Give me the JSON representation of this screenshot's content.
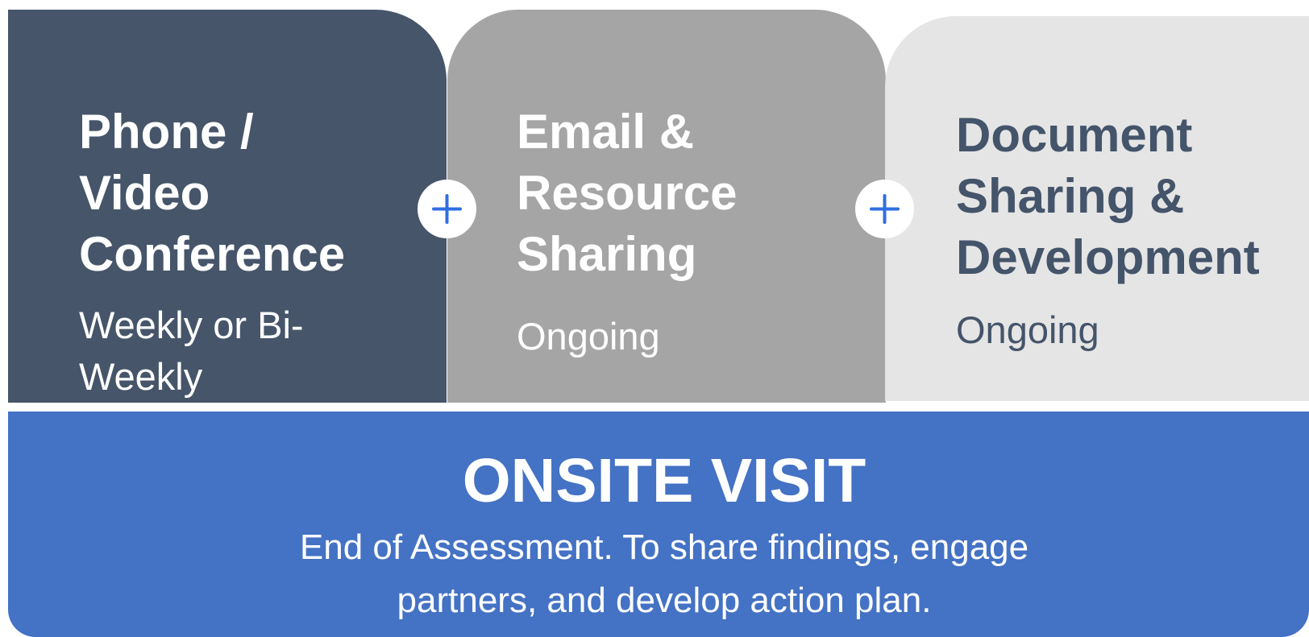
{
  "cards": [
    {
      "title": "Phone / Video Conference",
      "title_lines": [
        "Phone /",
        "Video",
        "Conference"
      ],
      "subtitle_lines": [
        "Weekly or Bi-",
        "Weekly"
      ],
      "color": "#465569"
    },
    {
      "title": "Email & Resource Sharing",
      "title_lines": [
        "Email &",
        "Resource",
        "Sharing"
      ],
      "subtitle_lines": [
        "Ongoing"
      ],
      "color": "#a5a5a5"
    },
    {
      "title": "Document Sharing & Development",
      "title_lines": [
        "Document",
        "Sharing &",
        "Development"
      ],
      "subtitle_lines": [
        "Ongoing"
      ],
      "color": "#e5e5e5"
    }
  ],
  "connectors": [
    {
      "icon": "plus-icon",
      "color": "#2f6fe0"
    },
    {
      "icon": "plus-icon",
      "color": "#2f6fe0"
    }
  ],
  "banner": {
    "title": "ONSITE VISIT",
    "text_lines": [
      "End of Assessment. To share findings, engage",
      "partners, and develop action plan."
    ],
    "color": "#4472c4"
  }
}
